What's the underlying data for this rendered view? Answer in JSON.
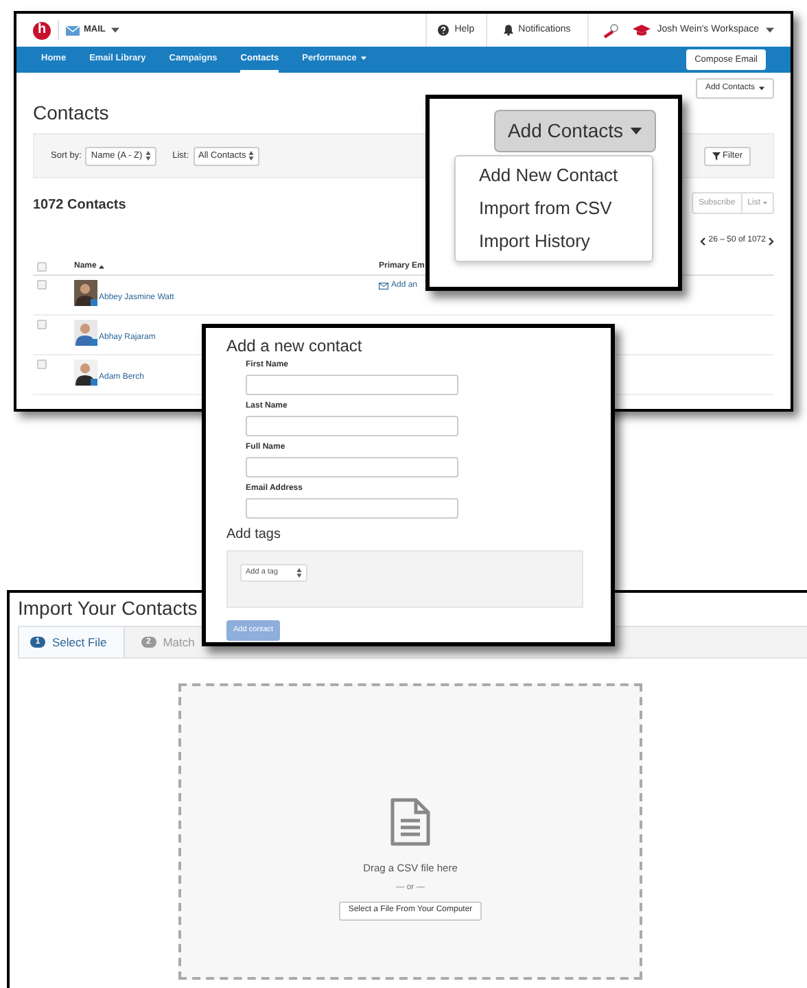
{
  "contacts_page": {
    "logo": "h",
    "app_name": "MAIL",
    "help": "Help",
    "notifications": "Notifications",
    "workspace": "Josh Wein's Workspace",
    "nav": [
      {
        "label": "Home",
        "selected": false,
        "has_menu": false
      },
      {
        "label": "Email Library",
        "selected": false,
        "has_menu": false
      },
      {
        "label": "Campaigns",
        "selected": false,
        "has_menu": false
      },
      {
        "label": "Contacts",
        "selected": true,
        "has_menu": false
      },
      {
        "label": "Performance",
        "selected": false,
        "has_menu": true
      }
    ],
    "compose_button": "Compose Email",
    "add_contacts_button": "Add Contacts",
    "title": "Contacts",
    "sort_label": "Sort by:",
    "sort_value": "Name (A - Z)",
    "list_label": "List:",
    "list_value": "All Contacts",
    "filter_button": "Filter",
    "count": "1072 Contacts",
    "subscribe_button": "Subscribe",
    "list_button": "List",
    "pagination": "26 – 50 of 1072",
    "select_all_checked": false,
    "columns": [
      "Name",
      "Primary Em"
    ],
    "rows": [
      {
        "name": "Abbey Jasmine Watt",
        "email": "Add an",
        "checked": false
      },
      {
        "name": "Abhay Rajaram",
        "checked": false
      },
      {
        "name": "Adam Berch",
        "checked": false
      }
    ]
  },
  "add_contacts_menu": {
    "button": "Add Contacts",
    "items": [
      "Add New Contact",
      "Import from CSV",
      "Import History"
    ]
  },
  "import_page": {
    "title": "Import Your Contacts",
    "steps": [
      {
        "number": "1",
        "label": "Select File",
        "selected": true
      },
      {
        "number": "2",
        "label": "Match",
        "selected": false
      }
    ],
    "drop_text": "Drag a CSV file here",
    "or_text": "— or —",
    "select_button": "Select a File From Your Computer"
  },
  "new_contact_form": {
    "title": "Add a new contact",
    "fields": [
      {
        "label": "First Name"
      },
      {
        "label": "Last Name"
      },
      {
        "label": "Full Name"
      },
      {
        "label": "Email Address"
      }
    ],
    "tags_title": "Add tags",
    "tag_select": "Add a tag",
    "submit_button": "Add contact"
  }
}
